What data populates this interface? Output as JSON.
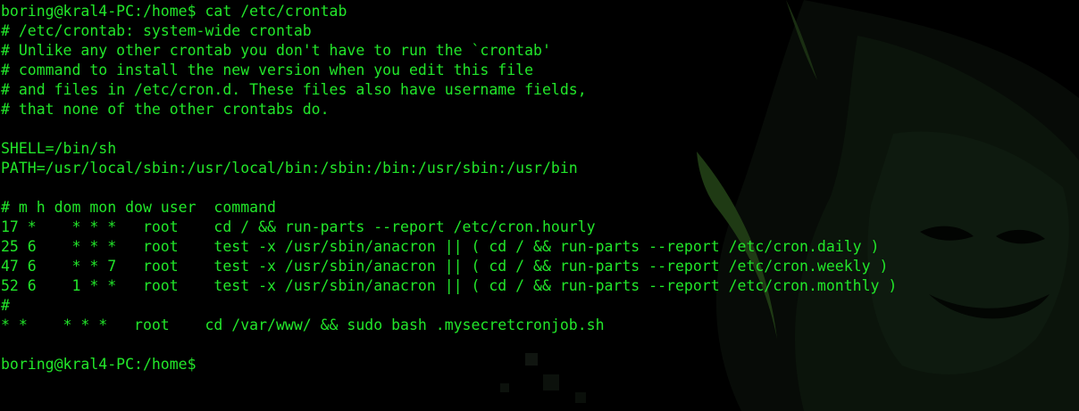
{
  "theme": {
    "text_color": "#22e62a",
    "background": "#000000",
    "wallpaper_tint": "#0d1a0e",
    "wallpaper_accent": "#1f3a14",
    "wallpaper_icon": "hacker-mask-icon"
  },
  "terminal": {
    "lines": [
      {
        "name": "command-line",
        "text": "boring@kral4-PC:/home$ cat /etc/crontab"
      },
      {
        "name": "comment-line",
        "text": "# /etc/crontab: system-wide crontab"
      },
      {
        "name": "comment-line",
        "text": "# Unlike any other crontab you don't have to run the `crontab'"
      },
      {
        "name": "comment-line",
        "text": "# command to install the new version when you edit this file"
      },
      {
        "name": "comment-line",
        "text": "# and files in /etc/cron.d. These files also have username fields,"
      },
      {
        "name": "comment-line",
        "text": "# that none of the other crontabs do."
      },
      {
        "name": "blank-line",
        "text": ""
      },
      {
        "name": "env-shell-line",
        "text": "SHELL=/bin/sh"
      },
      {
        "name": "env-path-line",
        "text": "PATH=/usr/local/sbin:/usr/local/bin:/sbin:/bin:/usr/sbin:/usr/bin"
      },
      {
        "name": "blank-line",
        "text": ""
      },
      {
        "name": "crontab-header-line",
        "text": "# m h dom mon dow user  command"
      },
      {
        "name": "cron-entry-hourly",
        "text": "17 *    * * *   root    cd / && run-parts --report /etc/cron.hourly"
      },
      {
        "name": "cron-entry-daily",
        "text": "25 6    * * *   root    test -x /usr/sbin/anacron || ( cd / && run-parts --report /etc/cron.daily )"
      },
      {
        "name": "cron-entry-weekly",
        "text": "47 6    * * 7   root    test -x /usr/sbin/anacron || ( cd / && run-parts --report /etc/cron.weekly )"
      },
      {
        "name": "cron-entry-monthly",
        "text": "52 6    1 * *   root    test -x /usr/sbin/anacron || ( cd / && run-parts --report /etc/cron.monthly )"
      },
      {
        "name": "comment-line",
        "text": "#"
      },
      {
        "name": "cron-entry-custom",
        "text": "* *    * * *   root    cd /var/www/ && sudo bash .mysecretcronjob.sh"
      },
      {
        "name": "blank-line",
        "text": ""
      },
      {
        "name": "prompt-line",
        "text": "boring@kral4-PC:/home$"
      }
    ]
  }
}
